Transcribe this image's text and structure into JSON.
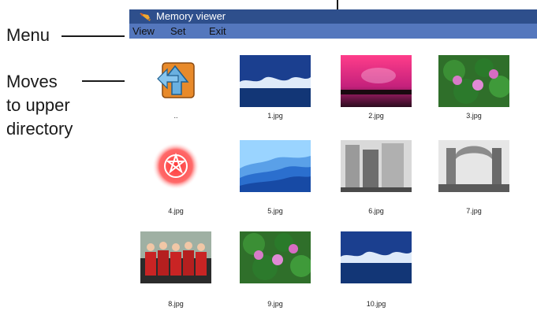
{
  "callouts": {
    "menu": "Menu",
    "moves_line1": "Moves",
    "moves_line2": "to upper",
    "moves_line3": "directory"
  },
  "window": {
    "title": "Memory viewer",
    "title_icon": "app-logo-icon",
    "menu": [
      "View",
      "Set",
      "Exit"
    ]
  },
  "thumbnails": [
    {
      "label": "..",
      "kind": "up-directory-icon"
    },
    {
      "label": "1.jpg",
      "kind": "waves-photo"
    },
    {
      "label": "2.jpg",
      "kind": "sunset-photo"
    },
    {
      "label": "3.jpg",
      "kind": "lotus-photo"
    },
    {
      "label": "4.jpg",
      "kind": "red-emblem-image"
    },
    {
      "label": "5.jpg",
      "kind": "blue-mountains-photo"
    },
    {
      "label": "6.jpg",
      "kind": "bw-street-photo"
    },
    {
      "label": "7.jpg",
      "kind": "bw-ruins-photo"
    },
    {
      "label": "8.jpg",
      "kind": "team-group-photo"
    },
    {
      "label": "9.jpg",
      "kind": "lotus-photo"
    },
    {
      "label": "10.jpg",
      "kind": "waves-photo"
    }
  ],
  "colors": {
    "titlebar": "#2e4f8c",
    "menubar": "#5477bd"
  }
}
